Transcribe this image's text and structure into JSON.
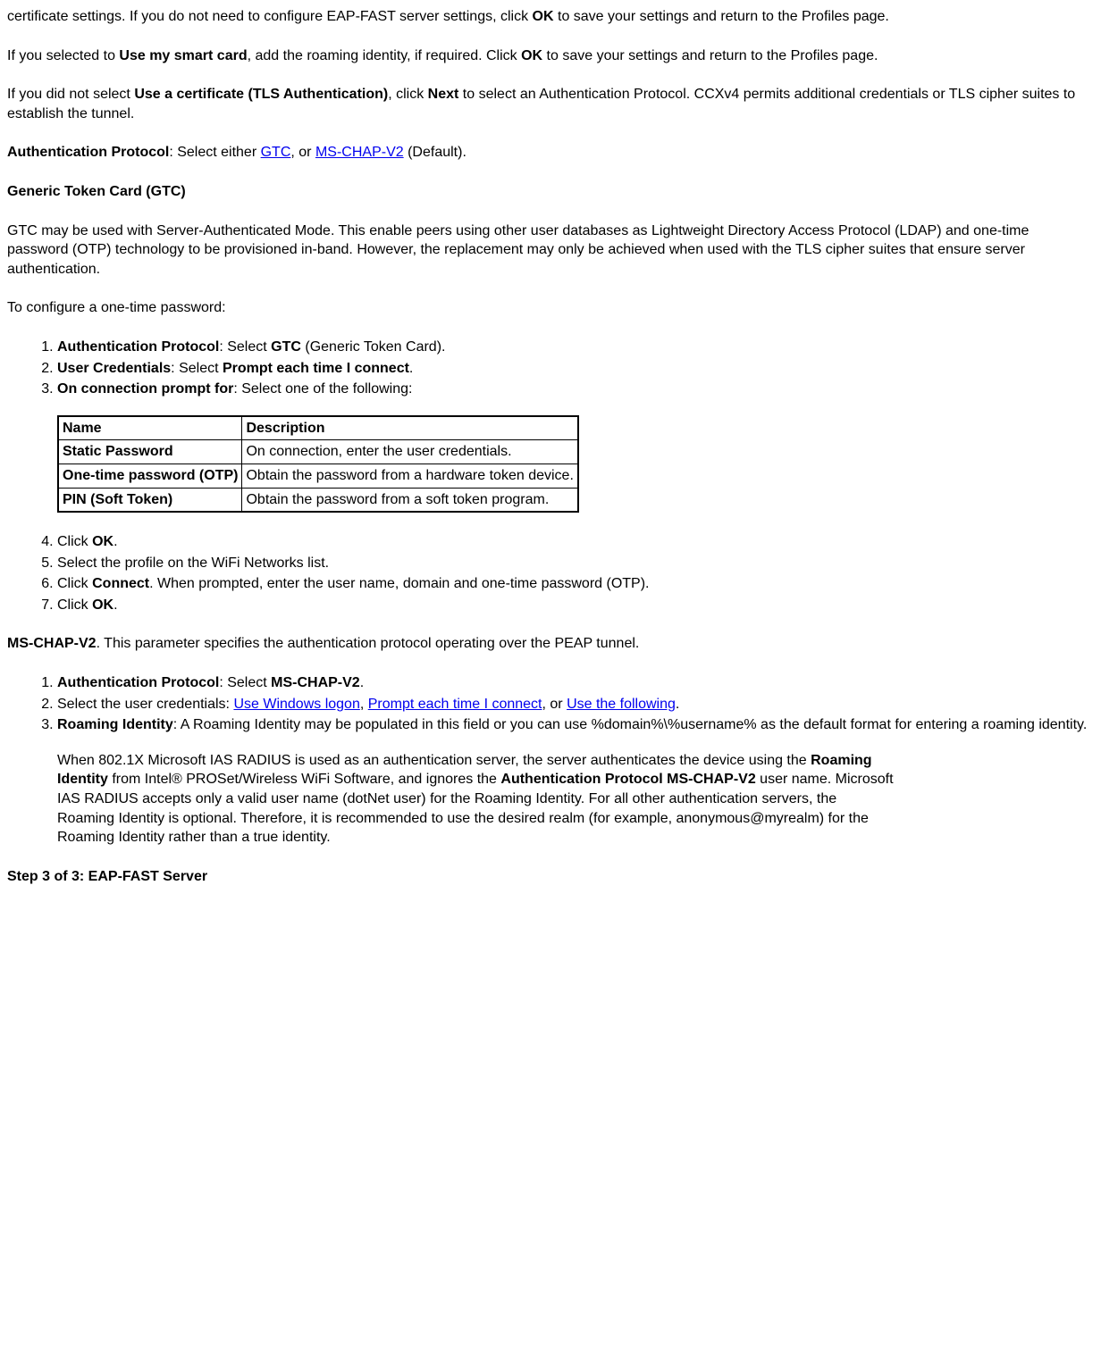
{
  "para_cert_settings": "certificate settings. If you do not need to configure EAP-FAST server settings, click ",
  "ok": "OK",
  "para_cert_settings_2": " to save your settings and return to the Profiles page.",
  "para_smartcard_1": "If you selected to ",
  "use_my_smart_card": "Use my smart card",
  "para_smartcard_2": ", add the roaming identity, if required. Click ",
  "para_smartcard_3": " to save your settings and return to the Profiles page.",
  "para_no_cert_1": "If you did not select ",
  "use_a_cert": "Use a certificate (TLS Authentication)",
  "para_no_cert_2": ", click ",
  "next": "Next",
  "para_no_cert_3": " to select an Authentication Protocol. CCXv4 permits additional credentials or TLS cipher suites to establish the tunnel.",
  "auth_proto_label": "Authentication Protocol",
  "auth_proto_text_1": ": Select either ",
  "gtc_link": "GTC",
  "auth_proto_text_2": ", or ",
  "mschap_link": "MS-CHAP-V2",
  "auth_proto_text_3": " (Default).",
  "gtc_heading": "Generic Token Card (GTC)",
  "gtc_desc": "GTC may be used with Server-Authenticated Mode. This enable peers using other user databases as Lightweight Directory Access Protocol (LDAP) and one-time password (OTP) technology to be provisioned in-band. However, the replacement may only be achieved when used with the TLS cipher suites that ensure server authentication.",
  "gtc_config_intro": "To configure a one-time password:",
  "gtc_steps": {
    "s1_a": "Authentication Protocol",
    "s1_b": ": Select ",
    "s1_c": "GTC",
    "s1_d": " (Generic Token Card).",
    "s2_a": "User Credentials",
    "s2_b": ": Select ",
    "s2_c": "Prompt each time I connect",
    "s2_d": ".",
    "s3_a": "On connection prompt for",
    "s3_b": ": Select one of the following:",
    "s4_a": "Click ",
    "s4_b": "OK",
    "s4_c": ".",
    "s5": "Select the profile on the WiFi Networks list.",
    "s6_a": "Click ",
    "s6_b": "Connect",
    "s6_c": ". When prompted, enter the user name, domain and one-time password (OTP).",
    "s7_a": "Click ",
    "s7_b": "OK",
    "s7_c": "."
  },
  "table": {
    "h1": "Name",
    "h2": "Description",
    "r1c1": "Static Password",
    "r1c2": "On connection, enter the user credentials.",
    "r2c1": "One-time password (OTP)",
    "r2c2": "Obtain the password from a hardware token device.",
    "r3c1": "PIN (Soft Token)",
    "r3c2": "Obtain the password from a soft token program."
  },
  "mschap_heading": "MS-CHAP-V2",
  "mschap_desc": ". This parameter specifies the authentication protocol operating over the PEAP tunnel.",
  "mschap_steps": {
    "s1_a": "Authentication Protocol",
    "s1_b": ": Select ",
    "s1_c": "MS-CHAP-V2",
    "s1_d": ".",
    "s2_a": "Select the user credentials: ",
    "s2_link1": "Use Windows logon",
    "s2_b": ", ",
    "s2_link2": "Prompt each time I connect",
    "s2_c": ", or ",
    "s2_link3": "Use the following",
    "s2_d": ".",
    "s3_a": "Roaming Identity",
    "s3_b": ": A Roaming Identity may be populated in this field or you can use %domain%\\%username% as the default format for entering a roaming identity.",
    "s3_para_1a": "When 802.1X Microsoft IAS RADIUS is used as an authentication server, the server authenticates the device using the ",
    "s3_para_1b": "Roaming Identity",
    "s3_para_1c": " from Intel® PROSet/Wireless WiFi Software, and ignores the ",
    "s3_para_1d": "Authentication Protocol MS-CHAP-V2",
    "s3_para_1e": " user name. Microsoft IAS RADIUS accepts only a valid user name (dotNet user) for the Roaming Identity. For all other authentication servers, the Roaming Identity is optional. Therefore, it is recommended to use the desired realm (for example, anonymous@myrealm) for the Roaming Identity rather than a true identity."
  },
  "step3_heading": "Step 3 of 3: EAP-FAST Server"
}
